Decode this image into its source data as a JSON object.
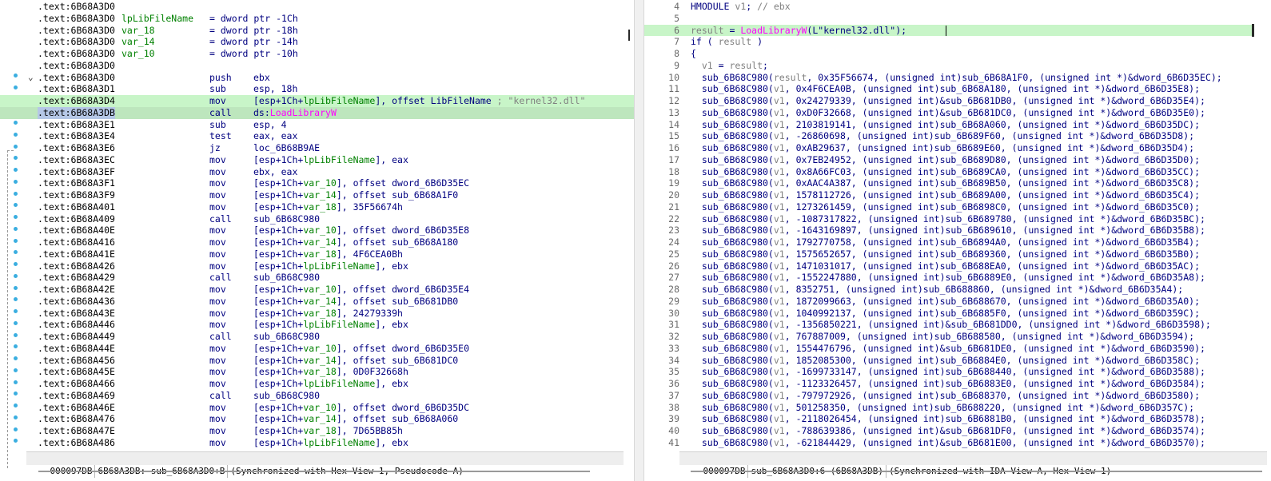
{
  "left_view": {
    "header_rows": [
      {
        "addr": ".text:6B68A3D0",
        "name": "",
        "decl": ""
      },
      {
        "addr": ".text:6B68A3D0",
        "name": "lpLibFileName",
        "decl": "= dword ptr -1Ch"
      },
      {
        "addr": ".text:6B68A3D0",
        "name": "var_18",
        "decl": "= dword ptr -18h"
      },
      {
        "addr": ".text:6B68A3D0",
        "name": "var_14",
        "decl": "= dword ptr -14h"
      },
      {
        "addr": ".text:6B68A3D0",
        "name": "var_10",
        "decl": "= dword ptr -10h"
      },
      {
        "addr": ".text:6B68A3D0",
        "name": "",
        "decl": ""
      }
    ],
    "instructions": [
      {
        "addr": ".text:6B68A3D0",
        "mnemonic": "push",
        "operand": "ebx"
      },
      {
        "addr": ".text:6B68A3D1",
        "mnemonic": "sub",
        "operand": "esp, 18h"
      },
      {
        "addr": ".text:6B68A3D4",
        "mnemonic": "mov",
        "operand": "[esp+1Ch+lpLibFileName], offset LibFileName",
        "comment": "; \"kernel32.dll\""
      },
      {
        "addr": ".text:6B68A3DB",
        "mnemonic": "call",
        "operand_prefix": "ds:",
        "operand_import": "LoadLibraryW"
      },
      {
        "addr": ".text:6B68A3E1",
        "mnemonic": "sub",
        "operand": "esp, 4"
      },
      {
        "addr": ".text:6B68A3E4",
        "mnemonic": "test",
        "operand": "eax, eax"
      },
      {
        "addr": ".text:6B68A3E6",
        "mnemonic": "jz",
        "operand": "loc_6B68B9AE"
      },
      {
        "addr": ".text:6B68A3EC",
        "mnemonic": "mov",
        "operand": "[esp+1Ch+lpLibFileName], eax"
      },
      {
        "addr": ".text:6B68A3EF",
        "mnemonic": "mov",
        "operand": "ebx, eax"
      },
      {
        "addr": ".text:6B68A3F1",
        "mnemonic": "mov",
        "operand": "[esp+1Ch+var_10], offset dword_6B6D35EC"
      },
      {
        "addr": ".text:6B68A3F9",
        "mnemonic": "mov",
        "operand": "[esp+1Ch+var_14], offset sub_6B68A1F0"
      },
      {
        "addr": ".text:6B68A401",
        "mnemonic": "mov",
        "operand": "[esp+1Ch+var_18], 35F56674h"
      },
      {
        "addr": ".text:6B68A409",
        "mnemonic": "call",
        "operand": "sub_6B68C980"
      },
      {
        "addr": ".text:6B68A40E",
        "mnemonic": "mov",
        "operand": "[esp+1Ch+var_10], offset dword_6B6D35E8"
      },
      {
        "addr": ".text:6B68A416",
        "mnemonic": "mov",
        "operand": "[esp+1Ch+var_14], offset sub_6B68A180"
      },
      {
        "addr": ".text:6B68A41E",
        "mnemonic": "mov",
        "operand": "[esp+1Ch+var_18], 4F6CEA0Bh"
      },
      {
        "addr": ".text:6B68A426",
        "mnemonic": "mov",
        "operand": "[esp+1Ch+lpLibFileName], ebx"
      },
      {
        "addr": ".text:6B68A429",
        "mnemonic": "call",
        "operand": "sub_6B68C980"
      },
      {
        "addr": ".text:6B68A42E",
        "mnemonic": "mov",
        "operand": "[esp+1Ch+var_10], offset dword_6B6D35E4"
      },
      {
        "addr": ".text:6B68A436",
        "mnemonic": "mov",
        "operand": "[esp+1Ch+var_14], offset sub_6B681DB0"
      },
      {
        "addr": ".text:6B68A43E",
        "mnemonic": "mov",
        "operand": "[esp+1Ch+var_18], 24279339h"
      },
      {
        "addr": ".text:6B68A446",
        "mnemonic": "mov",
        "operand": "[esp+1Ch+lpLibFileName], ebx"
      },
      {
        "addr": ".text:6B68A449",
        "mnemonic": "call",
        "operand": "sub_6B68C980"
      },
      {
        "addr": ".text:6B68A44E",
        "mnemonic": "mov",
        "operand": "[esp+1Ch+var_10], offset dword_6B6D35E0"
      },
      {
        "addr": ".text:6B68A456",
        "mnemonic": "mov",
        "operand": "[esp+1Ch+var_14], offset sub_6B681DC0"
      },
      {
        "addr": ".text:6B68A45E",
        "mnemonic": "mov",
        "operand": "[esp+1Ch+var_18], 0D0F32668h"
      },
      {
        "addr": ".text:6B68A466",
        "mnemonic": "mov",
        "operand": "[esp+1Ch+lpLibFileName], ebx"
      },
      {
        "addr": ".text:6B68A469",
        "mnemonic": "call",
        "operand": "sub_6B68C980"
      },
      {
        "addr": ".text:6B68A46E",
        "mnemonic": "mov",
        "operand": "[esp+1Ch+var_10], offset dword_6B6D35DC"
      },
      {
        "addr": ".text:6B68A476",
        "mnemonic": "mov",
        "operand": "[esp+1Ch+var_14], offset sub_6B68A060"
      },
      {
        "addr": ".text:6B68A47E",
        "mnemonic": "mov",
        "operand": "[esp+1Ch+var_18], 7D65BB85h"
      },
      {
        "addr": ".text:6B68A486",
        "mnemonic": "mov",
        "operand": "[esp+1Ch+lpLibFileName], ebx"
      }
    ],
    "status": {
      "offset": "000097DB",
      "location": "6B68A3DB: sub_6B68A3D0+B",
      "sync": "(Synchronized with Hex View-1, Pseudocode-A)"
    }
  },
  "right_view": {
    "lines": [
      {
        "num": "4",
        "text": "HMODULE v1; // ebx"
      },
      {
        "num": "5",
        "text": ""
      },
      {
        "num": "6",
        "text": "result = LoadLibraryW(L\"kernel32.dll\");"
      },
      {
        "num": "7",
        "text": "if ( result )"
      },
      {
        "num": "8",
        "text": "{"
      },
      {
        "num": "9",
        "text": "  v1 = result;"
      },
      {
        "num": "10",
        "text": "  sub_6B68C980(result, 0x35F56674, (unsigned int)sub_6B68A1F0, (unsigned int *)&dword_6B6D35EC);"
      },
      {
        "num": "11",
        "text": "  sub_6B68C980(v1, 0x4F6CEA0B, (unsigned int)sub_6B68A180, (unsigned int *)&dword_6B6D35E8);"
      },
      {
        "num": "12",
        "text": "  sub_6B68C980(v1, 0x24279339, (unsigned int)&sub_6B681DB0, (unsigned int *)&dword_6B6D35E4);"
      },
      {
        "num": "13",
        "text": "  sub_6B68C980(v1, 0xD0F32668, (unsigned int)&sub_6B681DC0, (unsigned int *)&dword_6B6D35E0);"
      },
      {
        "num": "14",
        "text": "  sub_6B68C980(v1, 2103819141, (unsigned int)sub_6B68A060, (unsigned int *)&dword_6B6D35DC);"
      },
      {
        "num": "15",
        "text": "  sub_6B68C980(v1, -26860698, (unsigned int)sub_6B689F60, (unsigned int *)&dword_6B6D35D8);"
      },
      {
        "num": "16",
        "text": "  sub_6B68C980(v1, 0xAB29637, (unsigned int)sub_6B689E60, (unsigned int *)&dword_6B6D35D4);"
      },
      {
        "num": "17",
        "text": "  sub_6B68C980(v1, 0x7EB24952, (unsigned int)sub_6B689D80, (unsigned int *)&dword_6B6D35D0);"
      },
      {
        "num": "18",
        "text": "  sub_6B68C980(v1, 0x8A66FC03, (unsigned int)sub_6B689CA0, (unsigned int *)&dword_6B6D35CC);"
      },
      {
        "num": "19",
        "text": "  sub_6B68C980(v1, 0xAAC4A387, (unsigned int)sub_6B689B50, (unsigned int *)&dword_6B6D35C8);"
      },
      {
        "num": "20",
        "text": "  sub_6B68C980(v1, 1578112726, (unsigned int)sub_6B689A00, (unsigned int *)&dword_6B6D35C4);"
      },
      {
        "num": "21",
        "text": "  sub_6B68C980(v1, 1273261459, (unsigned int)sub_6B6898C0, (unsigned int *)&dword_6B6D35C0);"
      },
      {
        "num": "22",
        "text": "  sub_6B68C980(v1, -1087317822, (unsigned int)sub_6B689780, (unsigned int *)&dword_6B6D35BC);"
      },
      {
        "num": "23",
        "text": "  sub_6B68C980(v1, -1643169897, (unsigned int)sub_6B689610, (unsigned int *)&dword_6B6D35B8);"
      },
      {
        "num": "24",
        "text": "  sub_6B68C980(v1, 1792770758, (unsigned int)sub_6B6894A0, (unsigned int *)&dword_6B6D35B4);"
      },
      {
        "num": "25",
        "text": "  sub_6B68C980(v1, 1575652657, (unsigned int)sub_6B689360, (unsigned int *)&dword_6B6D35B0);"
      },
      {
        "num": "26",
        "text": "  sub_6B68C980(v1, 1471031017, (unsigned int)sub_6B688EA0, (unsigned int *)&dword_6B6D35AC);"
      },
      {
        "num": "27",
        "text": "  sub_6B68C980(v1, -1552247880, (unsigned int)sub_6B6889E0, (unsigned int *)&dword_6B6D35A8);"
      },
      {
        "num": "28",
        "text": "  sub_6B68C980(v1, 8352751, (unsigned int)sub_6B688860, (unsigned int *)&dword_6B6D35A4);"
      },
      {
        "num": "29",
        "text": "  sub_6B68C980(v1, 1872099663, (unsigned int)sub_6B688670, (unsigned int *)&dword_6B6D35A0);"
      },
      {
        "num": "30",
        "text": "  sub_6B68C980(v1, 1040992137, (unsigned int)sub_6B6885F0, (unsigned int *)&dword_6B6D359C);"
      },
      {
        "num": "31",
        "text": "  sub_6B68C980(v1, -1356850221, (unsigned int)&sub_6B681DD0, (unsigned int *)&dword_6B6D3598);"
      },
      {
        "num": "32",
        "text": "  sub_6B68C980(v1, 767887009, (unsigned int)sub_6B688580, (unsigned int *)&dword_6B6D3594);"
      },
      {
        "num": "33",
        "text": "  sub_6B68C980(v1, 1554476796, (unsigned int)&sub_6B681DE0, (unsigned int *)&dword_6B6D3590);"
      },
      {
        "num": "34",
        "text": "  sub_6B68C980(v1, 1852085300, (unsigned int)sub_6B6884E0, (unsigned int *)&dword_6B6D358C);"
      },
      {
        "num": "35",
        "text": "  sub_6B68C980(v1, -1699733147, (unsigned int)sub_6B688440, (unsigned int *)&dword_6B6D3588);"
      },
      {
        "num": "36",
        "text": "  sub_6B68C980(v1, -1123326457, (unsigned int)sub_6B6883E0, (unsigned int *)&dword_6B6D3584);"
      },
      {
        "num": "37",
        "text": "  sub_6B68C980(v1, -797972926, (unsigned int)sub_6B688370, (unsigned int *)&dword_6B6D3580);"
      },
      {
        "num": "38",
        "text": "  sub_6B68C980(v1, 501258350, (unsigned int)sub_6B688220, (unsigned int *)&dword_6B6D357C);"
      },
      {
        "num": "39",
        "text": "  sub_6B68C980(v1, -2118026454, (unsigned int)sub_6B6881B0, (unsigned int *)&dword_6B6D3578);"
      },
      {
        "num": "40",
        "text": "  sub_6B68C980(v1, -788639386, (unsigned int)&sub_6B681DF0, (unsigned int *)&dword_6B6D3574);"
      },
      {
        "num": "41",
        "text": "  sub_6B68C980(v1, -621844429, (unsigned int)&sub_6B681E00, (unsigned int *)&dword_6B6D3570);"
      }
    ],
    "status": {
      "offset": "000097DB",
      "location": "sub_6B68A3D0:6 (6B68A3DB)",
      "sync": "(Synchronized with IDA View-A, Hex View-1)"
    }
  },
  "colors": {
    "highlight": "#c8f5c8",
    "keyword": "#000080",
    "import": "#ff00ff",
    "comment": "#808080",
    "variable": "#008000",
    "breakpoint_dot": "#3aaee0"
  },
  "icons": {
    "fold": "chevron-down-icon",
    "dot": "bullet-marker-icon"
  }
}
